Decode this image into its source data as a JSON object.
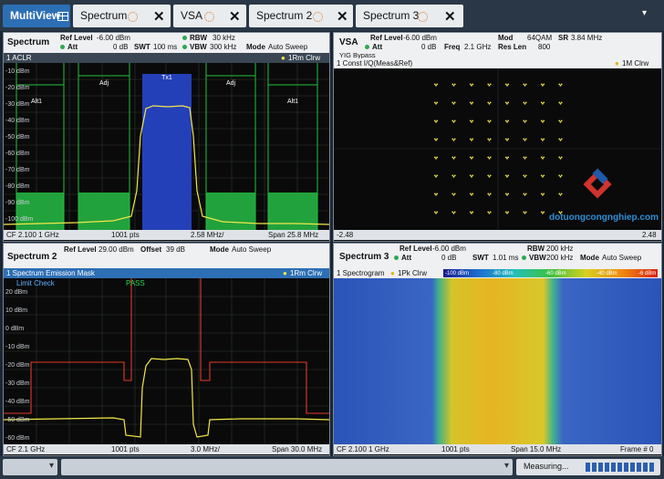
{
  "tabs": [
    {
      "label": "MultiView",
      "active": true
    },
    {
      "label": "Spectrum"
    },
    {
      "label": "VSA"
    },
    {
      "label": "Spectrum 2"
    },
    {
      "label": "Spectrum 3"
    }
  ],
  "tab_close_glyph": "✕",
  "tab_menu_glyph": "▾",
  "panel_tl": {
    "name": "Spectrum",
    "ref_level_label": "Ref Level",
    "ref_level": "-6.00 dBm",
    "att_label": "Att",
    "att": "0 dB",
    "swt_label": "SWT",
    "swt": "100 ms",
    "rbw_label": "RBW",
    "rbw": "30 kHz",
    "vbw_label": "VBW",
    "vbw": "300 kHz",
    "mode_label": "Mode",
    "mode": "Auto Sweep",
    "trace_title": "1 ACLR",
    "trace_badge": "1Rm Clrw",
    "channels": [
      "Alt1",
      "Adj",
      "Tx1",
      "Adj",
      "Alt1"
    ],
    "y_ticks": [
      "-10 dBm",
      "-20 dBm",
      "-30 dBm",
      "-40 dBm",
      "-50 dBm",
      "-60 dBm",
      "-70 dBm",
      "-80 dBm",
      "-90 dBm",
      "-100 dBm"
    ],
    "foot_left": "CF 2.100 1 GHz",
    "foot_mid": "1001 pts",
    "foot_mid2": "2.58 MHz/",
    "foot_right": "Span 25.8 MHz"
  },
  "panel_tr": {
    "name": "VSA",
    "ref_level_label": "Ref Level",
    "ref_level": "-6.00 dBm",
    "att_label": "Att",
    "att": "0 dB",
    "freq_label": "Freq",
    "freq": "2.1 GHz",
    "mod_label": "Mod",
    "mod": "64QAM",
    "sr_label": "SR",
    "sr": "3.84 MHz",
    "reslen_label": "Res Len",
    "reslen": "800",
    "yig": "YIG Bypass",
    "trace_title": "1 Const I/Q(Meas&Ref)",
    "trace_badge": "1M Clrw",
    "foot_left": "-2.48",
    "foot_right": "2.48",
    "watermark": "dotuongcongnghiep.com"
  },
  "panel_bl": {
    "name": "Spectrum 2",
    "ref_level_label": "Ref Level",
    "ref_level": "29.00 dBm",
    "offset_label": "Offset",
    "offset": "39 dB",
    "mode_label": "Mode",
    "mode": "Auto Sweep",
    "trace_title": "1 Spectrum Emission Mask",
    "trace_badge": "1Rm Clrw",
    "limit_check": "Limit Check",
    "pass": "PASS",
    "y_ticks": [
      "20 dBm",
      "10 dBm",
      "0 dBm",
      "-10 dBm",
      "-20 dBm",
      "-30 dBm",
      "-40 dBm",
      "-50 dBm",
      "-60 dBm"
    ],
    "foot_left": "CF 2.1 GHz",
    "foot_mid": "1001 pts",
    "foot_mid2": "3.0 MHz/",
    "foot_right": "Span 30.0 MHz"
  },
  "panel_br": {
    "name": "Spectrum 3",
    "ref_level_label": "Ref Level",
    "ref_level": "-6.00 dBm",
    "att_label": "Att",
    "att": "0 dB",
    "swt_label": "SWT",
    "swt": "1.01 ms",
    "rbw_label": "RBW",
    "rbw": "200 kHz",
    "vbw_label": "VBW",
    "vbw": "200 kHz",
    "mode_label": "Mode",
    "mode": "Auto Sweep",
    "trace_title": "1 Spectrogram",
    "trace_badge": "1Pk Clrw",
    "colorbar_labels": [
      "-100 dBm",
      "-80 dBm",
      "-60 dBm",
      "-40 dBm",
      "-6 dBm"
    ],
    "foot_left": "CF 2.100 1 GHz",
    "foot_mid": "1001 pts",
    "foot_mid2": "Span 15.0 MHz",
    "foot_right": "Frame # 0"
  },
  "status": {
    "measuring": "Measuring..."
  },
  "colors": {
    "trace_yellow": "#f2e84a",
    "limit_red": "#e23a2c",
    "channel_green": "#22a23c",
    "tx_blue": "#2440b8"
  }
}
